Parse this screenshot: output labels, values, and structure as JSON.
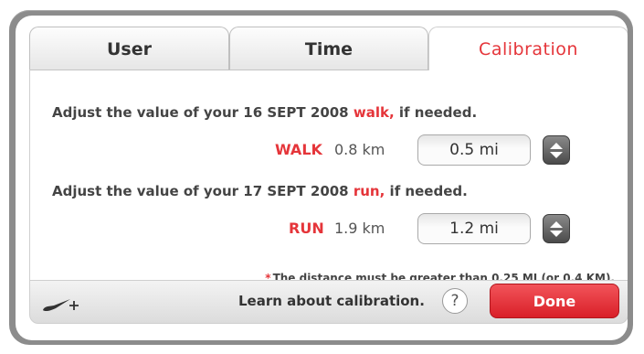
{
  "tabs": [
    {
      "label": "User"
    },
    {
      "label": "Time"
    },
    {
      "label": "Calibration"
    }
  ],
  "calibration": {
    "walk": {
      "prompt_prefix": "Adjust the value of your 16 SEPT 2008",
      "activity_word": "walk,",
      "prompt_suffix": "if needed.",
      "label": "WALK",
      "measured": "0.8 km",
      "value": "0.5 mi"
    },
    "run": {
      "prompt_prefix": "Adjust the value of your 17 SEPT 2008",
      "activity_word": "run,",
      "prompt_suffix": "if needed.",
      "label": "RUN",
      "measured": "1.9 km",
      "value": "1.2 mi"
    },
    "note_star": "*",
    "note": "The distance must be greater than 0.25 MI (or 0.4 KM)."
  },
  "footer": {
    "learn_text": "Learn about calibration.",
    "help_label": "?",
    "done_label": "Done"
  },
  "colors": {
    "accent": "#e5353a",
    "frame": "#8c8c8c"
  },
  "icons": {
    "logo": "nike-plus-swoosh-icon",
    "stepper": "up-down-arrows-icon"
  }
}
